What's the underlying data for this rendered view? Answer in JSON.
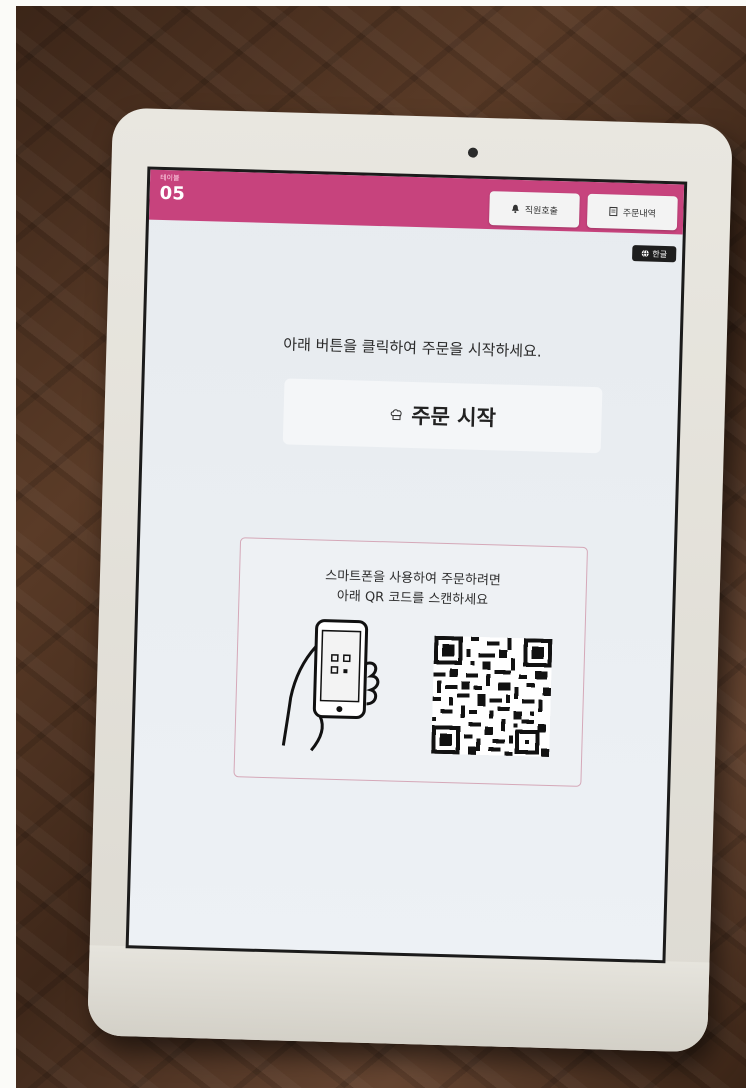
{
  "header": {
    "table_label": "테이블",
    "table_number": "05",
    "staff_call_label": "직원호출",
    "staff_call_icon": "bell-icon",
    "order_history_label": "주문내역",
    "order_history_icon": "receipt-icon"
  },
  "language": {
    "icon": "globe-icon",
    "label": "한글"
  },
  "main": {
    "instruction": "아래 버튼을 클릭하여 주문을 시작하세요.",
    "start_button_label": "주문 시작",
    "start_button_icon": "chef-hat-icon"
  },
  "qr_panel": {
    "line1": "스마트폰을 사용하여 주문하려면",
    "line2": "아래 QR 코드를 스캔하세요"
  },
  "colors": {
    "accent": "#c7437d",
    "screen_bg": "#e7ebef",
    "button_bg": "#f4f6f8"
  }
}
